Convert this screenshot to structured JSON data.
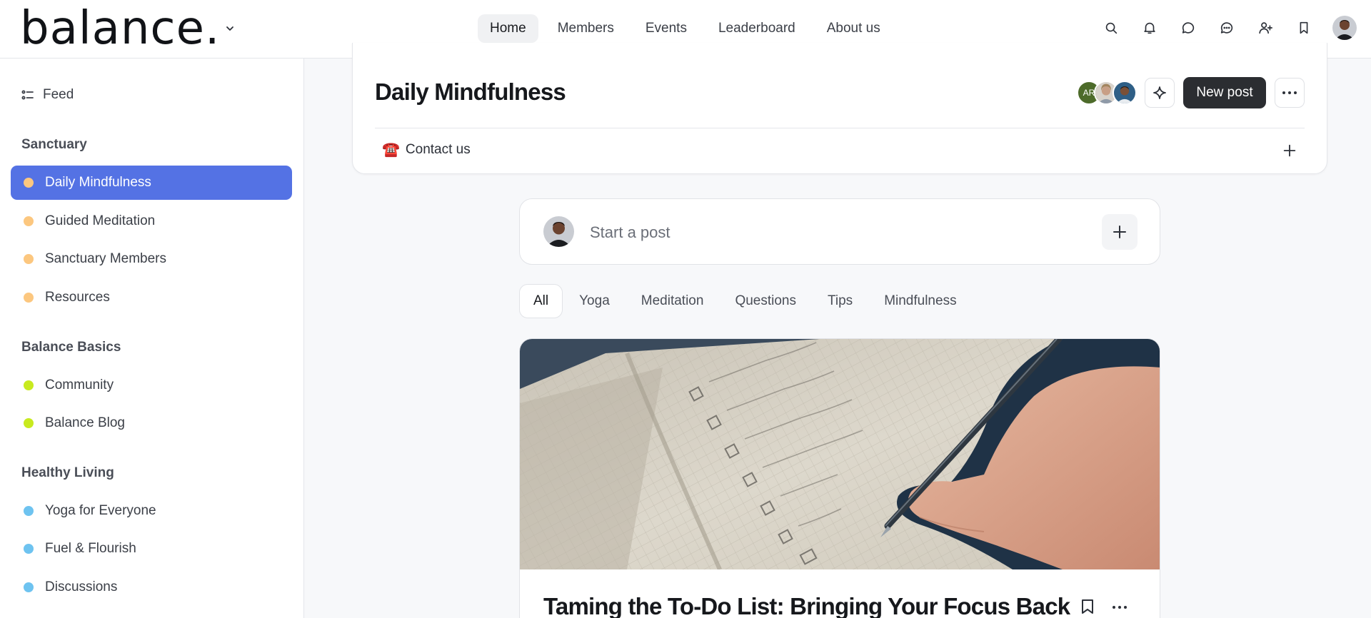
{
  "app": {
    "logo_text": "balance."
  },
  "nav": {
    "items": [
      {
        "label": "Home",
        "active": true
      },
      {
        "label": "Members"
      },
      {
        "label": "Events"
      },
      {
        "label": "Leaderboard"
      },
      {
        "label": "About us"
      }
    ]
  },
  "top_icons": [
    "search-icon",
    "bell-icon",
    "chat-bubble-icon",
    "messages-icon",
    "add-user-icon",
    "bookmark-icon"
  ],
  "sidebar": {
    "feed_label": "Feed",
    "sections": [
      {
        "title": "Sanctuary",
        "items": [
          {
            "label": "Daily Mindfulness",
            "dot": "#fcc77f",
            "active": true
          },
          {
            "label": "Guided Meditation",
            "dot": "#fcc77f"
          },
          {
            "label": "Sanctuary Members",
            "dot": "#fcc77f"
          },
          {
            "label": "Resources",
            "dot": "#fcc77f"
          }
        ]
      },
      {
        "title": "Balance Basics",
        "items": [
          {
            "label": "Community",
            "dot": "#c8ea1f"
          },
          {
            "label": "Balance Blog",
            "dot": "#c8ea1f"
          }
        ]
      },
      {
        "title": "Healthy Living",
        "items": [
          {
            "label": "Yoga for Everyone",
            "dot": "#6ec3f0"
          },
          {
            "label": "Fuel & Flourish",
            "dot": "#6ec3f0"
          },
          {
            "label": "Discussions",
            "dot": "#6ec3f0"
          }
        ]
      }
    ]
  },
  "space": {
    "title": "Daily Mindfulness",
    "member_avatar_initials": "AR",
    "new_post_label": "New post",
    "contact_icon": "☎️",
    "contact_label": "Contact us"
  },
  "composer": {
    "placeholder": "Start a post"
  },
  "tabs": [
    {
      "label": "All",
      "active": true
    },
    {
      "label": "Yoga"
    },
    {
      "label": "Meditation"
    },
    {
      "label": "Questions"
    },
    {
      "label": "Tips"
    },
    {
      "label": "Mindfulness"
    }
  ],
  "post": {
    "title": "Taming the To-Do List: Bringing Your Focus Back"
  },
  "colors": {
    "accent": "#5472e4",
    "new_post_bg": "#2b2d31"
  }
}
